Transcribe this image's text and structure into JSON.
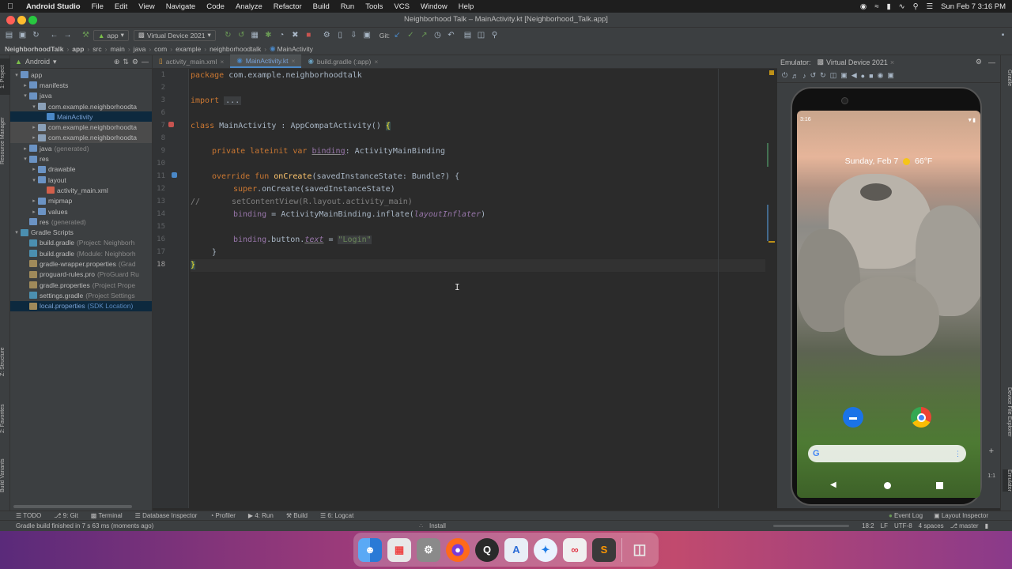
{
  "mac_menu": {
    "app": "Android Studio",
    "items": [
      "File",
      "Edit",
      "View",
      "Navigate",
      "Code",
      "Analyze",
      "Refactor",
      "Build",
      "Run",
      "Tools",
      "VCS",
      "Window",
      "Help"
    ],
    "clock": "Sun Feb 7  3:16 PM"
  },
  "window": {
    "title": "Neighborhood Talk – MainActivity.kt [Neighborhood_Talk.app]"
  },
  "toolbar": {
    "config": "app",
    "device": "Virtual Device 2021",
    "git_label": "Git:"
  },
  "breadcrumbs": [
    "NeighborhoodTalk",
    "app",
    "src",
    "main",
    "java",
    "com",
    "example",
    "neighborhoodtalk",
    "MainActivity"
  ],
  "project_panel": {
    "view": "Android",
    "rows": [
      {
        "label": "app",
        "extra": "",
        "indent": 0,
        "arrow": "▾",
        "icon": "folder"
      },
      {
        "label": "manifests",
        "extra": "",
        "indent": 1,
        "arrow": "▸",
        "icon": "folder"
      },
      {
        "label": "java",
        "extra": "",
        "indent": 1,
        "arrow": "▾",
        "icon": "folder"
      },
      {
        "label": "com.example.neighborhoodta",
        "extra": "",
        "indent": 2,
        "arrow": "▾",
        "icon": "package"
      },
      {
        "label": "MainActivity",
        "extra": "",
        "indent": 3,
        "arrow": "",
        "icon": "kotlin"
      },
      {
        "label": "com.example.neighborhoodta",
        "extra": "",
        "indent": 2,
        "arrow": "▸",
        "icon": "package"
      },
      {
        "label": "com.example.neighborhoodta",
        "extra": "",
        "indent": 2,
        "arrow": "▸",
        "icon": "package"
      },
      {
        "label": "java",
        "extra": "(generated)",
        "indent": 1,
        "arrow": "▸",
        "icon": "folder"
      },
      {
        "label": "res",
        "extra": "",
        "indent": 1,
        "arrow": "▾",
        "icon": "folder"
      },
      {
        "label": "drawable",
        "extra": "",
        "indent": 2,
        "arrow": "▸",
        "icon": "folder"
      },
      {
        "label": "layout",
        "extra": "",
        "indent": 2,
        "arrow": "▾",
        "icon": "folder"
      },
      {
        "label": "activity_main.xml",
        "extra": "",
        "indent": 3,
        "arrow": "",
        "icon": "xml"
      },
      {
        "label": "mipmap",
        "extra": "",
        "indent": 2,
        "arrow": "▸",
        "icon": "folder"
      },
      {
        "label": "values",
        "extra": "",
        "indent": 2,
        "arrow": "▸",
        "icon": "folder"
      },
      {
        "label": "res",
        "extra": "(generated)",
        "indent": 1,
        "arrow": "",
        "icon": "folder"
      },
      {
        "label": "Gradle Scripts",
        "extra": "",
        "indent": 0,
        "arrow": "▾",
        "icon": "gradle"
      },
      {
        "label": "build.gradle",
        "extra": "(Project: Neighborh",
        "indent": 1,
        "arrow": "",
        "icon": "gradle"
      },
      {
        "label": "build.gradle",
        "extra": "(Module: Neighborh",
        "indent": 1,
        "arrow": "",
        "icon": "gradle"
      },
      {
        "label": "gradle-wrapper.properties",
        "extra": "(Grad",
        "indent": 1,
        "arrow": "",
        "icon": "props"
      },
      {
        "label": "proguard-rules.pro",
        "extra": "(ProGuard Ru",
        "indent": 1,
        "arrow": "",
        "icon": "props"
      },
      {
        "label": "gradle.properties",
        "extra": "(Project Prope",
        "indent": 1,
        "arrow": "",
        "icon": "props"
      },
      {
        "label": "settings.gradle",
        "extra": "(Project Settings",
        "indent": 1,
        "arrow": "",
        "icon": "gradle"
      },
      {
        "label": "local.properties",
        "extra": "(SDK Location)",
        "indent": 1,
        "arrow": "",
        "icon": "props"
      }
    ]
  },
  "editor_tabs": [
    {
      "label": "activity_main.xml",
      "active": false
    },
    {
      "label": "MainActivity.kt",
      "active": true
    },
    {
      "label": "build.gradle (:app)",
      "active": false
    }
  ],
  "code": {
    "package_kw": "package",
    "package_name": "com.example.neighborhoodtalk",
    "import_kw": "import",
    "import_fold": "...",
    "class_kw": "class",
    "class_name": "MainActivity",
    "class_sep": " : ",
    "superclass": "AppCompatActivity()",
    "open_brace": "{",
    "prop_mods": "private lateinit var",
    "prop_name": "binding",
    "prop_type": ": ActivityMainBinding",
    "fun_mods": "override fun",
    "fun_name": "onCreate",
    "fun_params": "(savedInstanceState: Bundle?) {",
    "super_kw": "super",
    "super_call": ".onCreate(savedInstanceState)",
    "comment_mark": "//",
    "commented": "setContentView(R.layout.activity_main)",
    "bind_assign_name": "binding",
    "bind_assign_mid": " = ActivityMainBinding.inflate(",
    "bind_assign_arg": "layoutInflater",
    "bind_assign_end": ")",
    "text_obj": "binding",
    "text_mid": ".button.",
    "text_prop": "text",
    "text_eq": " = ",
    "text_value": "\"Login\"",
    "fun_close": "}",
    "class_close": "}"
  },
  "line_numbers": [
    "1",
    "2",
    "3",
    "6",
    "7",
    "8",
    "9",
    "10",
    "11",
    "12",
    "13",
    "14",
    "15",
    "16",
    "17",
    "18"
  ],
  "emulator": {
    "label": "Emulator:",
    "device": "Virtual Device 2021",
    "status_time": "3:16",
    "glance": "Sunday, Feb 7",
    "weather": "66°F",
    "zoom": "1:1"
  },
  "left_stripe": [
    "1: Project",
    "Resource Manager",
    "Z: Structure",
    "2: Favorites",
    "Build Variants"
  ],
  "right_stripe": [
    "Gradle",
    "Device File Explorer",
    "Emulator"
  ],
  "bottom_tools": [
    "TODO",
    "9: Git",
    "Terminal",
    "Database Inspector",
    "Profiler",
    "4: Run",
    "Build",
    "6: Logcat"
  ],
  "bottom_tools_right": [
    "Event Log",
    "Layout Inspector"
  ],
  "status": {
    "message": "Gradle build finished in 7 s 63 ms (moments ago)",
    "task": "Install",
    "position": "18:2",
    "line_sep": "LF",
    "encoding": "UTF-8",
    "indent": "4 spaces",
    "branch": "master"
  },
  "colors": {
    "keyword": "#cc7832",
    "function": "#ffc66d",
    "property": "#9876aa",
    "string": "#6a8759",
    "selection": "#0d293e",
    "accent": "#4a88c7"
  }
}
